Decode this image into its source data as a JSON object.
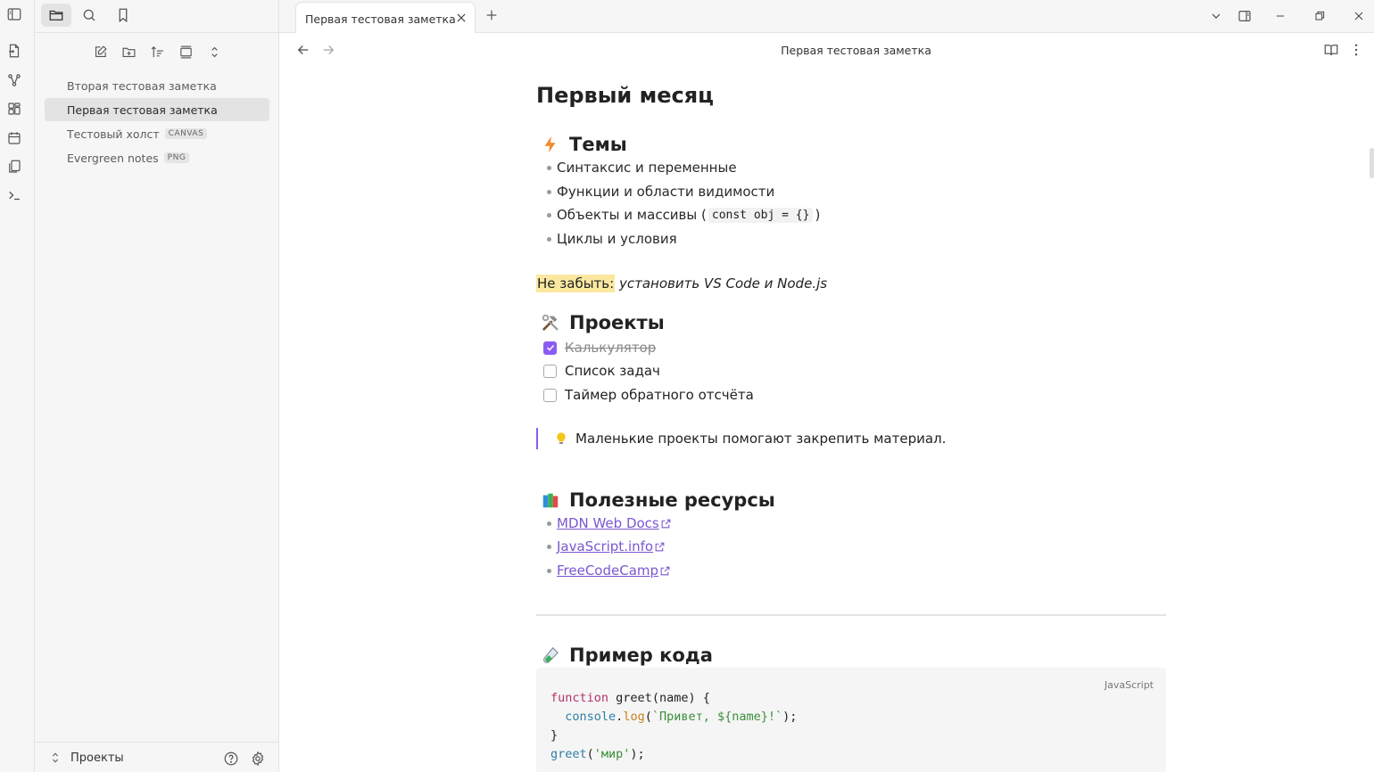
{
  "tabbar": {
    "active_tab_title": "Первая тестовая заметка"
  },
  "view_header": {
    "title": "Первая тестовая заметка"
  },
  "sidebar": {
    "files": [
      {
        "name": "Вторая тестовая заметка",
        "tag": "",
        "active": false
      },
      {
        "name": "Первая тестовая заметка",
        "tag": "",
        "active": true
      },
      {
        "name": "Тестовый холст",
        "tag": "CANVAS",
        "active": false
      },
      {
        "name": "Evergreen notes",
        "tag": "PNG",
        "active": false
      }
    ],
    "vault_name": "Проекты"
  },
  "note": {
    "h1": "Первый месяц",
    "topics": {
      "heading": "Темы",
      "items": [
        "Синтаксис и переменные",
        "Функции и области видимости",
        "Объекты и массивы (",
        "Циклы и условия"
      ],
      "inline_code": "const obj = {}",
      "code_suffix": ")"
    },
    "reminder": {
      "highlight": "Не забыть:",
      "text": "установить VS Code и Node.js"
    },
    "projects": {
      "heading": "Проекты",
      "tasks": [
        {
          "label": "Калькулятор",
          "checked": true
        },
        {
          "label": "Список задач",
          "checked": false
        },
        {
          "label": "Таймер обратного отсчёта",
          "checked": false
        }
      ]
    },
    "quote": "Маленькие проекты помогают закрепить материал.",
    "resources": {
      "heading": "Полезные ресурсы",
      "links": [
        "MDN Web Docs",
        "JavaScript.info",
        "FreeCodeCamp"
      ]
    },
    "code": {
      "heading": "Пример кода",
      "language": "JavaScript",
      "kw_function": "function",
      "fn_name": "greet",
      "params": "(name) {",
      "console": "console",
      "dot": ".",
      "log": "log",
      "open_paren": "(",
      "template": "`Привет, ${name}!`",
      "close_stmt": ");",
      "close_brace": "}",
      "call_name": "greet",
      "call_open": "(",
      "call_arg": "'мир'",
      "call_close": ");"
    }
  },
  "colors": {
    "accent": "#8a5cf5",
    "link": "#7a57d1",
    "highlight": "#fbe8a0"
  }
}
